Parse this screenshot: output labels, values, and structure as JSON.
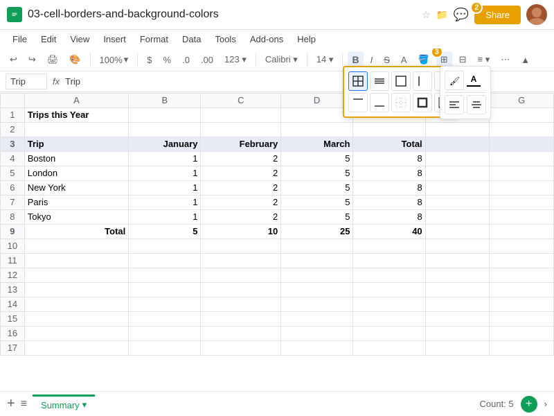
{
  "titleBar": {
    "filename": "03-cell-borders-and-background-colors",
    "shareLabel": "Share",
    "badge2": "2"
  },
  "menuBar": {
    "items": [
      "File",
      "Edit",
      "View",
      "Insert",
      "Format",
      "Data",
      "Tools",
      "Add-ons",
      "Help"
    ]
  },
  "toolbar": {
    "zoom": "100%",
    "dollarSign": "$",
    "percentSign": "%",
    "decimalOne": ".0",
    "decimalTwo": ".00",
    "format123": "123",
    "font": "Calibri",
    "fontSize": "14",
    "boldLabel": "B",
    "italicLabel": "I",
    "strikeLabel": "S̶",
    "badge3": "3"
  },
  "formulaBar": {
    "cellRef": "Trip",
    "fxLabel": "fx",
    "value": "Trip"
  },
  "columns": {
    "rowHeader": "",
    "headers": [
      "A",
      "B",
      "C",
      "D",
      "E",
      "F",
      "G"
    ]
  },
  "rows": [
    {
      "num": 1,
      "cells": [
        "Trips this Year",
        "",
        "",
        "",
        "",
        "",
        ""
      ]
    },
    {
      "num": 2,
      "cells": [
        "",
        "",
        "",
        "",
        "",
        "",
        ""
      ]
    },
    {
      "num": 3,
      "cells": [
        "Trip",
        "January",
        "February",
        "March",
        "Total",
        "",
        ""
      ],
      "style": "header"
    },
    {
      "num": 4,
      "cells": [
        "Boston",
        "1",
        "2",
        "5",
        "8",
        "",
        ""
      ]
    },
    {
      "num": 5,
      "cells": [
        "London",
        "1",
        "2",
        "5",
        "8",
        "",
        ""
      ]
    },
    {
      "num": 6,
      "cells": [
        "New York",
        "1",
        "2",
        "5",
        "8",
        "",
        ""
      ]
    },
    {
      "num": 7,
      "cells": [
        "Paris",
        "1",
        "2",
        "5",
        "8",
        "",
        ""
      ]
    },
    {
      "num": 8,
      "cells": [
        "Tokyo",
        "1",
        "2",
        "5",
        "8",
        "",
        ""
      ]
    },
    {
      "num": 9,
      "cells": [
        "Total",
        "5",
        "10",
        "25",
        "40",
        "",
        ""
      ],
      "style": "total"
    },
    {
      "num": 10,
      "cells": [
        "",
        "",
        "",
        "",
        "",
        "",
        ""
      ]
    },
    {
      "num": 11,
      "cells": [
        "",
        "",
        "",
        "",
        "",
        "",
        ""
      ]
    },
    {
      "num": 12,
      "cells": [
        "",
        "",
        "",
        "",
        "",
        "",
        ""
      ]
    },
    {
      "num": 13,
      "cells": [
        "",
        "",
        "",
        "",
        "",
        "",
        ""
      ]
    },
    {
      "num": 14,
      "cells": [
        "",
        "",
        "",
        "",
        "",
        "",
        ""
      ]
    },
    {
      "num": 15,
      "cells": [
        "",
        "",
        "",
        "",
        "",
        "",
        ""
      ]
    },
    {
      "num": 16,
      "cells": [
        "",
        "",
        "",
        "",
        "",
        "",
        ""
      ]
    },
    {
      "num": 17,
      "cells": [
        "",
        "",
        "",
        "",
        "",
        "",
        ""
      ]
    }
  ],
  "borderPopup": {
    "options": [
      {
        "id": "all",
        "label": "all borders"
      },
      {
        "id": "inner",
        "label": "inner borders"
      },
      {
        "id": "outer",
        "label": "outer borders"
      },
      {
        "id": "left",
        "label": "left border"
      },
      {
        "id": "right",
        "label": "right border"
      },
      {
        "id": "top",
        "label": "top border"
      },
      {
        "id": "bottom",
        "label": "bottom border"
      },
      {
        "id": "no",
        "label": "no borders"
      },
      {
        "id": "left-right",
        "label": "left-right borders"
      },
      {
        "id": "top-bottom",
        "label": "top-bottom borders"
      }
    ]
  },
  "bottomBar": {
    "sheetName": "Summary",
    "chevron": "▾",
    "countLabel": "Count: 5",
    "addIcon": "+",
    "menuIcon": "≡"
  }
}
